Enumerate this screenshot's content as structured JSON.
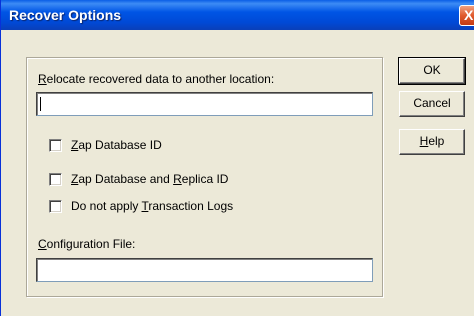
{
  "window": {
    "title": "Recover Options",
    "close_glyph": "X"
  },
  "form": {
    "relocate_label_pre": "",
    "relocate_label_mnemonic": "R",
    "relocate_label_post": "elocate recovered data to another location:",
    "relocate_value": "",
    "checkboxes": [
      {
        "pre": "",
        "mnemonic": "Z",
        "post": "ap Database ID",
        "checked": false
      },
      {
        "pre": "",
        "mnemonic": "Z",
        "post": "ap Database and ",
        "mnemonic2": "R",
        "post2": "eplica ID",
        "checked": false
      },
      {
        "pre": "Do not apply ",
        "mnemonic": "T",
        "post": "ransaction Logs",
        "checked": false
      }
    ],
    "config_label_pre": "",
    "config_label_mnemonic": "C",
    "config_label_post": "onfiguration File:",
    "config_value": ""
  },
  "buttons": {
    "ok": "OK",
    "cancel": "Cancel",
    "help_mnemonic": "H",
    "help_post": "elp"
  }
}
